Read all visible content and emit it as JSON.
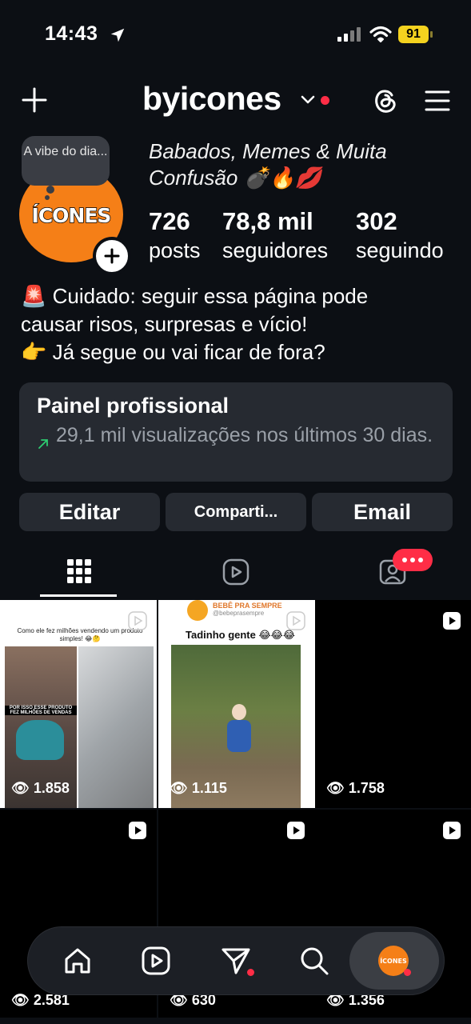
{
  "status": {
    "time": "14:43",
    "battery": "91"
  },
  "header": {
    "username": "byicones"
  },
  "avatar": {
    "text": "ÍCONES",
    "note": "A vibe do dia..."
  },
  "profile": {
    "title_line": "Babados, Memes & Muita Confusão 💣🔥💋",
    "stats": [
      {
        "value": "726",
        "label": "posts"
      },
      {
        "value": "78,8 mil",
        "label": "seguidores"
      },
      {
        "value": "302",
        "label": "seguindo"
      }
    ],
    "bio_lines": [
      "🚨 Cuidado: seguir essa página pode",
      "causar risos, surpresas e vício!",
      "👉 Já segue ou vai ficar de fora?"
    ]
  },
  "dashboard": {
    "title": "Painel profissional",
    "subtitle": "29,1 mil visualizações nos últimos 30 dias."
  },
  "buttons": {
    "edit": "Editar",
    "share": "Comparti...",
    "email": "Email"
  },
  "grid": [
    {
      "views": "1.858",
      "caption": "Como ele fez milhões vendendo um produto simples! 😂🤔",
      "overlay": "POR ISSO ESSE PRODUTO FEZ MILHÕES DE VENDAS"
    },
    {
      "views": "1.115",
      "brand": "BEBÊ PRA SEMPRE",
      "handle": "@bebeprasempre",
      "caption": "Tadinho gente 😂😂😂"
    },
    {
      "views": "1.758"
    },
    {
      "views": "2.581"
    },
    {
      "views": "630"
    },
    {
      "views": "1.356"
    }
  ],
  "nav": {
    "profile_text": "ÍCONES"
  },
  "colors": {
    "background": "#0c0f14",
    "card": "#262a31",
    "accent_red": "#ff2d46",
    "brand_orange": "#f57f17"
  }
}
